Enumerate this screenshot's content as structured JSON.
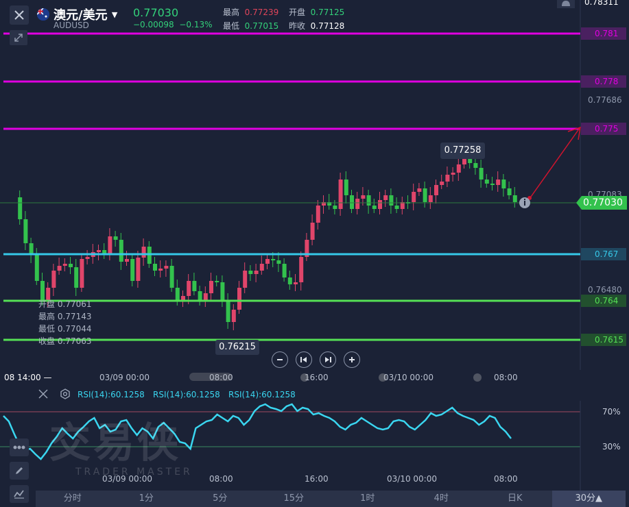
{
  "header": {
    "symbol_name": "澳元/美元",
    "symbol_code": "AUDUSD",
    "last_price": "0.77030",
    "change": "−0.00098",
    "change_pct": "−0.13%",
    "high_label": "最高",
    "high_value": "0.77239",
    "low_label": "最低",
    "low_value": "0.77015",
    "open_label": "开盘",
    "open_value": "0.77125",
    "prev_close_label": "昨收",
    "prev_close_value": "0.77128"
  },
  "price_axis": {
    "top_value": "0.78311",
    "ticks": [
      "0.77686",
      "0.77083",
      "0.76480"
    ],
    "current_tag": "0.77030"
  },
  "levels": [
    {
      "label": "0.781",
      "color": "#e000e0"
    },
    {
      "label": "0.778",
      "color": "#e000e0"
    },
    {
      "label": "0.775",
      "color": "#e000e0"
    },
    {
      "label": "0.767",
      "color": "#36c8e8"
    },
    {
      "label": "0.764",
      "color": "#55e055"
    },
    {
      "label": "0.7615",
      "color": "#55e055"
    }
  ],
  "callouts": {
    "high_marker": "0.77258",
    "low_marker": "0.76215"
  },
  "ohlc_panel": {
    "open_label": "开盘",
    "open_value": "0.77061",
    "high_label": "最高",
    "high_value": "0.77143",
    "low_label": "最低",
    "low_value": "0.77044",
    "close_label": "收盘",
    "close_value": "0.77063"
  },
  "time_axis": {
    "crosshair_time": "08 14:00",
    "labels": [
      "03/09 00:00",
      "08:00",
      "16:00",
      "03/10 00:00",
      "08:00"
    ]
  },
  "rsi": {
    "labels": [
      "RSI(14):60.1258",
      "RSI(14):60.1258",
      "RSI(14):60.1258"
    ],
    "upper": "70%",
    "lower": "30%",
    "time_labels": [
      "03/09 00:00",
      "08:00",
      "16:00",
      "03/10 00:00",
      "08:00"
    ]
  },
  "watermark": {
    "main": "交易侠",
    "sub": "TRADER MASTER"
  },
  "timeframes": [
    "分时",
    "1分",
    "5分",
    "15分",
    "1时",
    "4时",
    "日K",
    "30分▲"
  ],
  "active_timeframe": "30分▲",
  "colors": {
    "up": "#33c24d",
    "down": "#e0456a",
    "magenta": "#e000e0",
    "cyan": "#36c8e8",
    "green_level": "#55e055",
    "rsi_line": "#3ad6f0"
  }
}
